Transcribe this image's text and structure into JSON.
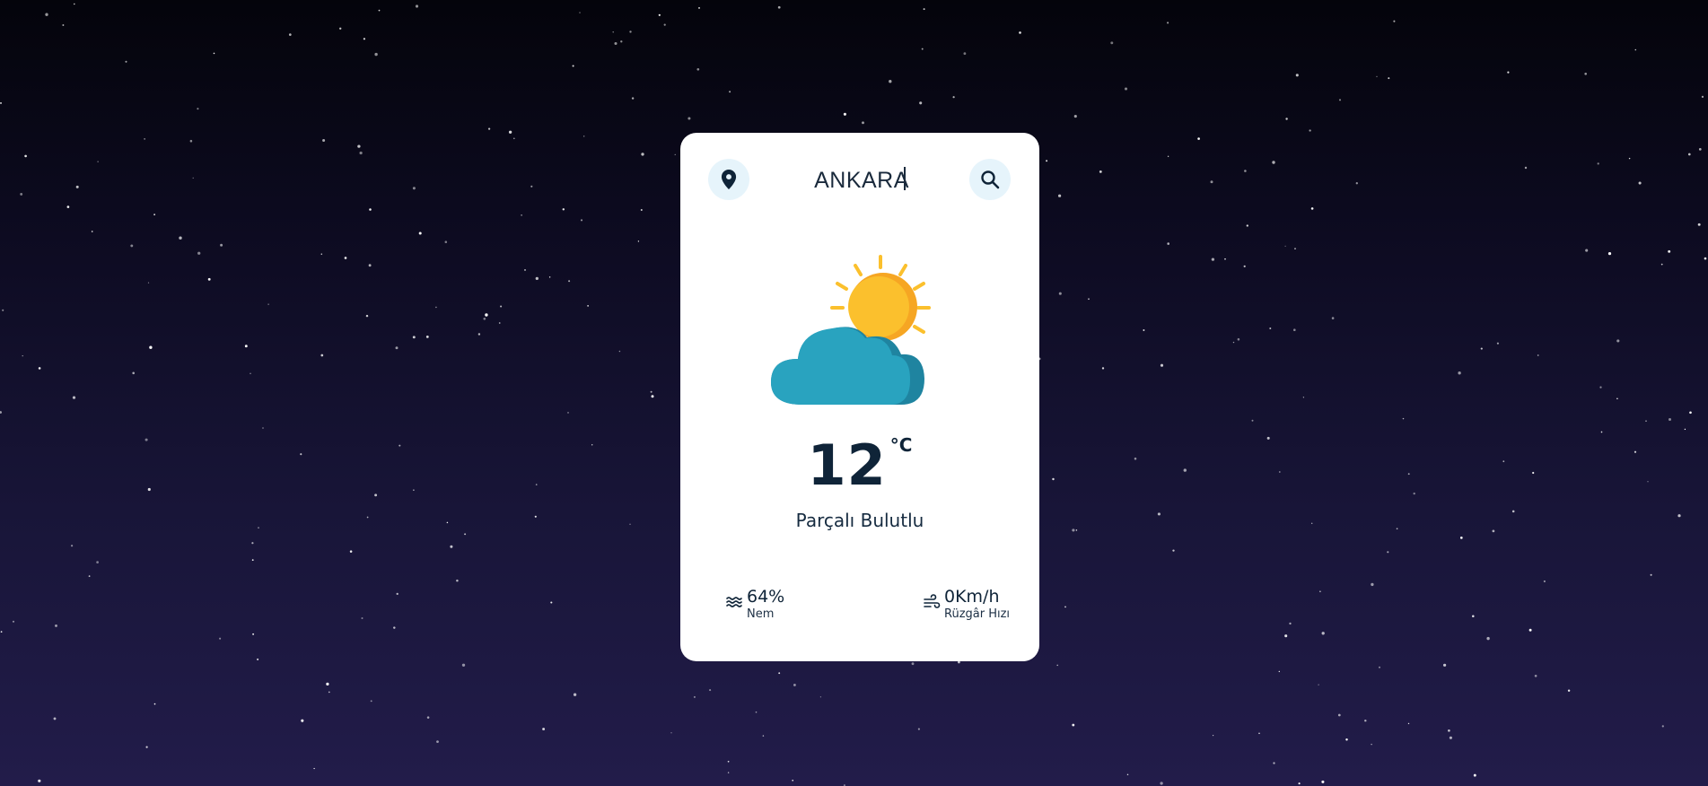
{
  "search": {
    "value": "ANKARA",
    "location_icon": "map-pin-icon",
    "search_icon": "search-icon"
  },
  "weather": {
    "condition_icon": "partly-cloudy-icon",
    "temperature": "12",
    "unit": "°C",
    "description": "Parçalı Bulutlu"
  },
  "humidity": {
    "icon": "humidity-waves-icon",
    "value": "64%",
    "label": "Nem"
  },
  "wind": {
    "icon": "wind-icon",
    "value": "0Km/h",
    "label": "Rüzgâr Hızı"
  },
  "colors": {
    "card_background": "#ffffff",
    "icon_button_bg": "#e6f4fb",
    "text_primary": "#0f2438",
    "sun": "#fbc02d",
    "sun_shadow": "#f6a623",
    "cloud": "#29a3bf",
    "cloud_shadow": "#1f84a0",
    "sky_top": "#04040b",
    "sky_bottom": "#221c4a"
  }
}
